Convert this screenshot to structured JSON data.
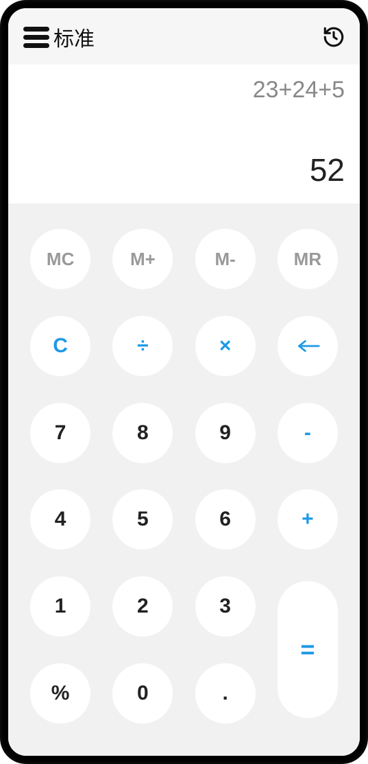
{
  "header": {
    "title": "标准"
  },
  "display": {
    "expression": "23+24+5",
    "result": "52"
  },
  "memory": {
    "mc": "MC",
    "mplus": "M+",
    "mminus": "M-",
    "mr": "MR"
  },
  "keys": {
    "clear": "C",
    "divide": "÷",
    "multiply": "×",
    "backspace": "⇐",
    "seven": "7",
    "eight": "8",
    "nine": "9",
    "minus": "-",
    "four": "4",
    "five": "5",
    "six": "6",
    "plus": "+",
    "one": "1",
    "two": "2",
    "three": "3",
    "equals": "=",
    "percent": "%",
    "zero": "0",
    "decimal": "."
  }
}
